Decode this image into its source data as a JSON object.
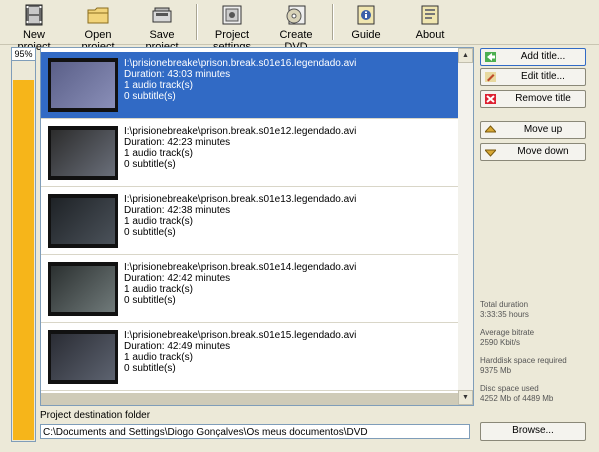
{
  "toolbar": {
    "new_project": "New project",
    "open_project": "Open project",
    "save_project": "Save project",
    "project_settings": "Project settings",
    "create_dvd": "Create DVD",
    "guide": "Guide",
    "about": "About"
  },
  "progress": {
    "label": "95%",
    "value": 0.95,
    "color": "#F6B51A"
  },
  "titles": [
    {
      "path": "I:\\prisionebreake\\prison.break.s01e16.legendado.avi",
      "duration": "Duration: 43:03 minutes",
      "audio": "1 audio track(s)",
      "subtitles": "0 subtitle(s)",
      "selected": true
    },
    {
      "path": "I:\\prisionebreake\\prison.break.s01e12.legendado.avi",
      "duration": "Duration: 42:23 minutes",
      "audio": "1 audio track(s)",
      "subtitles": "0 subtitle(s)",
      "selected": false
    },
    {
      "path": "I:\\prisionebreake\\prison.break.s01e13.legendado.avi",
      "duration": "Duration: 42:38 minutes",
      "audio": "1 audio track(s)",
      "subtitles": "0 subtitle(s)",
      "selected": false
    },
    {
      "path": "I:\\prisionebreake\\prison.break.s01e14.legendado.avi",
      "duration": "Duration: 42:42 minutes",
      "audio": "1 audio track(s)",
      "subtitles": "0 subtitle(s)",
      "selected": false
    },
    {
      "path": "I:\\prisionebreake\\prison.break.s01e15.legendado.avi",
      "duration": "Duration: 42:49 minutes",
      "audio": "1 audio track(s)",
      "subtitles": "0 subtitle(s)",
      "selected": false
    }
  ],
  "buttons": {
    "add_title": "Add title...",
    "edit_title": "Edit title...",
    "remove_title": "Remove title",
    "move_up": "Move up",
    "move_down": "Move down",
    "browse": "Browse..."
  },
  "stats": {
    "total_duration_label": "Total duration",
    "total_duration_value": "3:33:35 hours",
    "avg_bitrate_label": "Average bitrate",
    "avg_bitrate_value": "2590 Kbit/s",
    "hdd_label": "Harddisk space required",
    "hdd_value": "9375 Mb",
    "disc_label": "Disc space used",
    "disc_value": "4252 Mb of 4489 Mb"
  },
  "destination": {
    "label": "Project destination folder",
    "value": "C:\\Documents and Settings\\Diogo Gonçalves\\Os meus documentos\\DVD"
  }
}
